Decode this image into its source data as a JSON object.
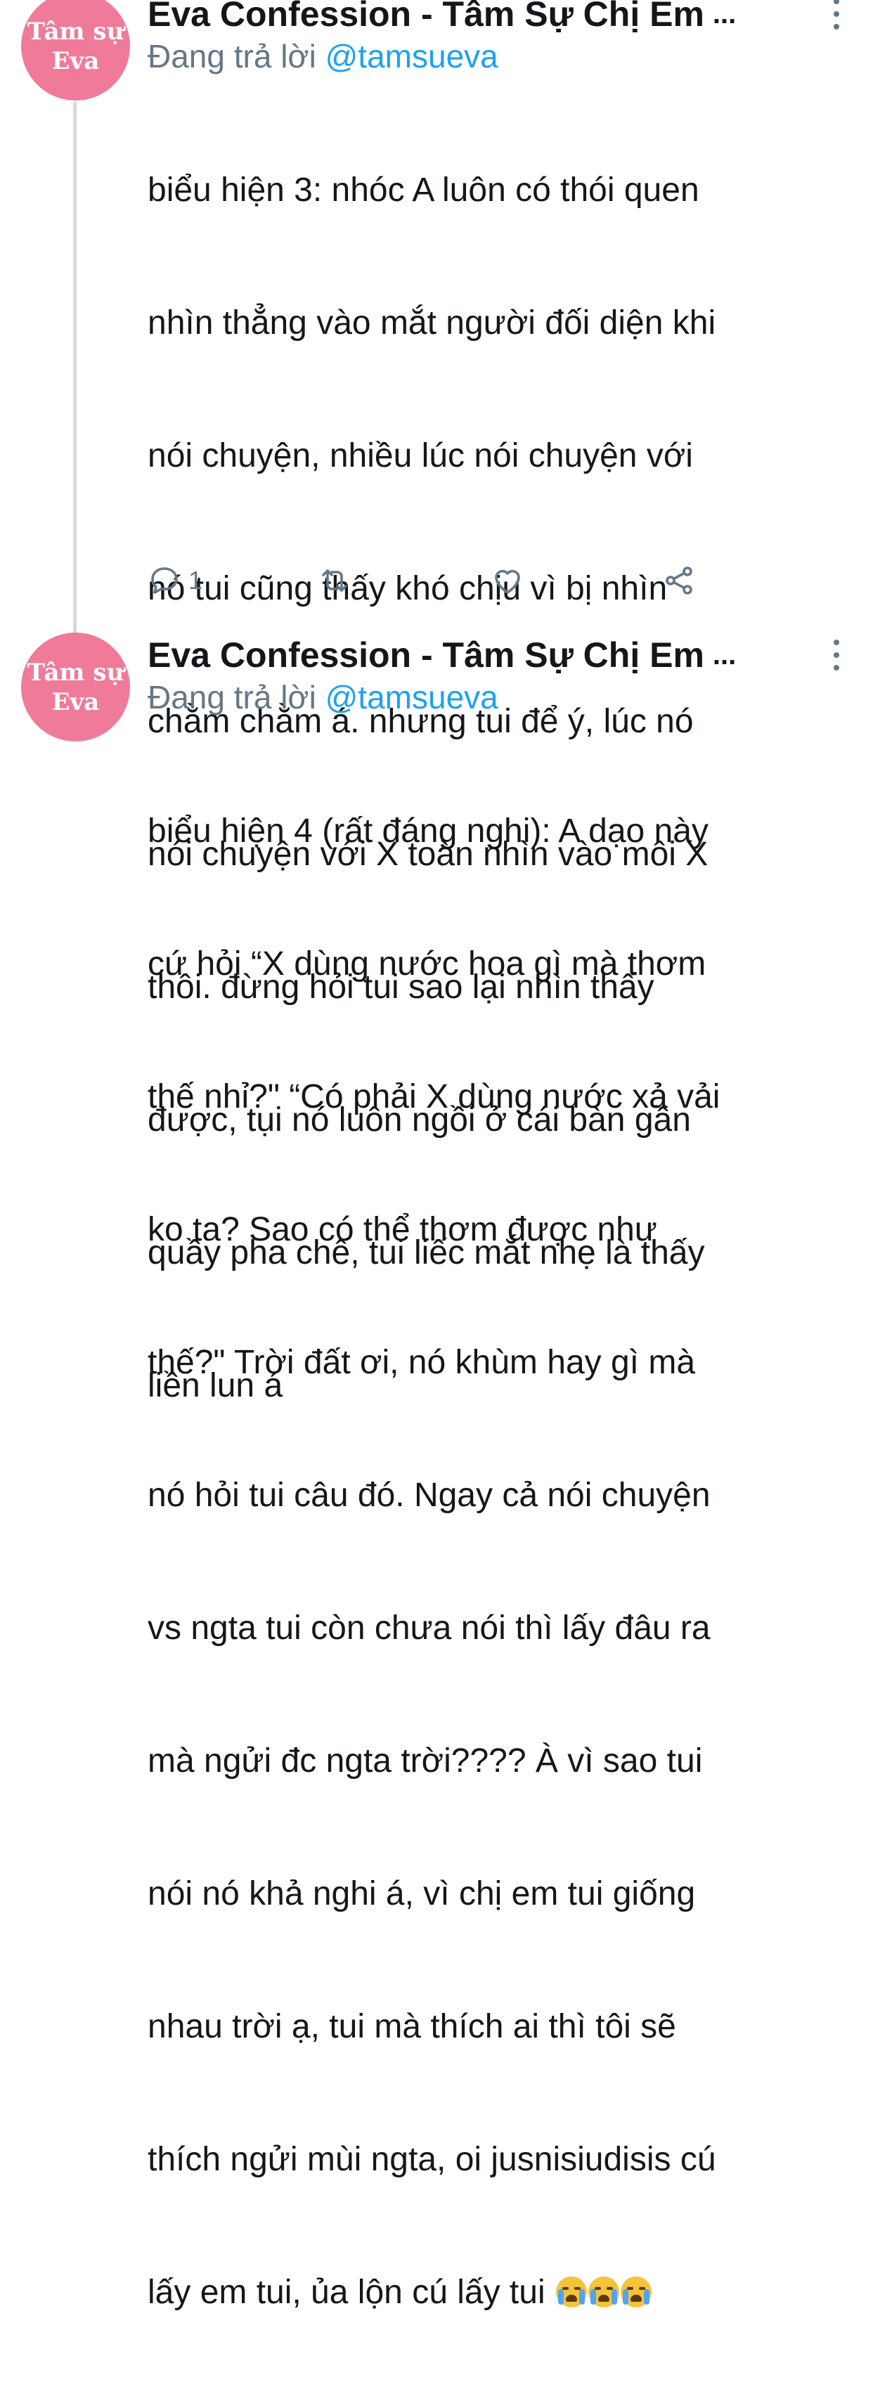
{
  "tweets": [
    {
      "avatar_line1": "Tâm sự",
      "avatar_line2": "Eva",
      "name": "Eva Confession - Tâm Sự Chị Em",
      "name_ellipsis": "...",
      "reply_prefix": "Đang trả lời",
      "reply_handle": "@tamsueva",
      "lines": [
        "biểu hiện 3: nhóc A luôn có thói quen",
        "nhìn thẳng vào mắt người đối diện khi",
        "nói chuyện, nhiều lúc nói chuyện với",
        "nó tui cũng thấy khó chịu vì bị nhìn",
        "chằm chằm á. nhưng tui để ý, lúc nó",
        "nói chuyện với X toàn nhìn vào môi X",
        "thôi. đừng hỏi tui sao lại nhìn thấy",
        "được, tụi nó luôn ngồi ở cái bàn gần",
        "quầy pha chế, tui liếc mắt nhẹ là thấy",
        "liền lun á"
      ],
      "reply_count": "1",
      "icons": [
        "reply-icon",
        "retweet-icon",
        "like-icon",
        "share-icon"
      ]
    },
    {
      "avatar_line1": "Tâm sự",
      "avatar_line2": "Eva",
      "name": "Eva Confession - Tâm Sự Chị Em",
      "name_ellipsis": "...",
      "reply_prefix": "Đang trả lời",
      "reply_handle": "@tamsueva",
      "lines": [
        "biểu hiện 4 (rất đáng nghi): A dạo này",
        "cứ hỏi “X dùng nước hoa gì mà thơm",
        "thế nhỉ?\" “Có phải X dùng nước xả vải",
        "ko ta? Sao có thể thơm được như",
        "thế?\" Trời đất ơi, nó khùm hay gì mà",
        "nó hỏi tui câu đó. Ngay cả nói chuyện",
        "vs ngta tui còn chưa nói thì lấy đâu ra",
        "mà ngửi đc ngta trời???? À vì sao tui",
        "nói nó khả nghi á, vì chị em tui giống",
        "nhau trời ạ, tui mà thích ai thì tôi sẽ",
        "thích ngửi mùi ngta, oi jusnisiudisis cú",
        "lấy em tui, ủa lộn cú lấy tui"
      ],
      "trailing_emoji": "loudly-crying-face x3"
    }
  ],
  "colors": {
    "avatar_bg": "#f07a9a",
    "handle": "#1da1f2",
    "muted": "#657786",
    "text": "#14171a",
    "thread_line": "#d6d9dc"
  }
}
